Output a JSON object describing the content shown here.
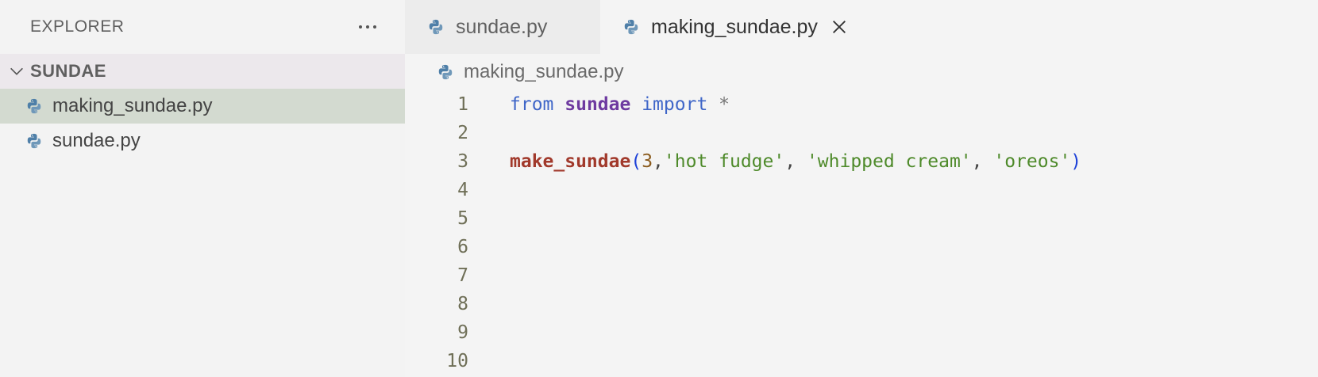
{
  "explorer": {
    "title": "EXPLORER",
    "folder": "SUNDAE",
    "files": [
      {
        "name": "making_sundae.py",
        "selected": true
      },
      {
        "name": "sundae.py",
        "selected": false
      }
    ]
  },
  "tabs": [
    {
      "label": "sundae.py",
      "active": false
    },
    {
      "label": "making_sundae.py",
      "active": true
    }
  ],
  "breadcrumb": "making_sundae.py",
  "code": {
    "line_numbers": [
      "1",
      "2",
      "3",
      "4",
      "5",
      "6",
      "7",
      "8",
      "9",
      "10"
    ],
    "line1": {
      "from": "from",
      "module": "sundae",
      "import": "import",
      "star": "*"
    },
    "line3": {
      "func": "make_sundae",
      "open": "(",
      "arg1": "3",
      "arg2": "'hot fudge'",
      "arg3": "'whipped cream'",
      "arg4": "'oreos'",
      "close": ")"
    }
  },
  "icons": {
    "file": "python-icon",
    "folder_toggle": "chevron-down-icon",
    "close": "close-icon",
    "more": "more-actions-icon"
  }
}
